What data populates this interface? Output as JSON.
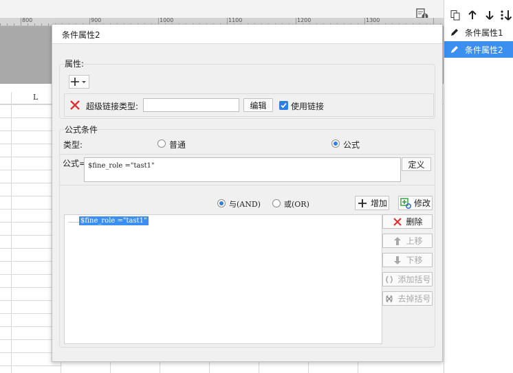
{
  "ruler": {
    "labels": [
      "800",
      "900",
      "1000",
      "1100",
      "1200",
      "1300"
    ]
  },
  "sheet": {
    "column_letter": "L"
  },
  "right_panel": {
    "items": [
      {
        "label": "条件属性1",
        "selected": false
      },
      {
        "label": "条件属性2",
        "selected": true
      }
    ]
  },
  "dialog": {
    "title": "条件属性2",
    "attributes": {
      "legend": "属性:",
      "hyperlink_type_label": "超级链接类型:",
      "hyperlink_type_value": "",
      "edit_button": "编辑",
      "use_link_label": "使用链接",
      "use_link_checked": true
    },
    "formula_condition": {
      "legend": "公式条件",
      "type_label": "类型:",
      "type_options": [
        "普通",
        "公式"
      ],
      "type_selected": "公式",
      "formula_label": "公式=",
      "formula_value": "$fine_role =\"tast1\"",
      "define_button": "定义",
      "logic_options": [
        "与(AND)",
        "或(OR)"
      ],
      "logic_selected": "与(AND)",
      "add_button": "增加",
      "modify_button": "修改",
      "list_items": [
        "$fine_role =\"tast1\""
      ],
      "delete_button": "删除",
      "move_up_button": "上移",
      "move_down_button": "下移",
      "add_bracket_button": "添加括号",
      "remove_bracket_button": "去掉括号"
    }
  },
  "colors": {
    "accent": "#3b8ff0",
    "delete_red": "#e03030",
    "add_green": "#2e9a3a"
  }
}
